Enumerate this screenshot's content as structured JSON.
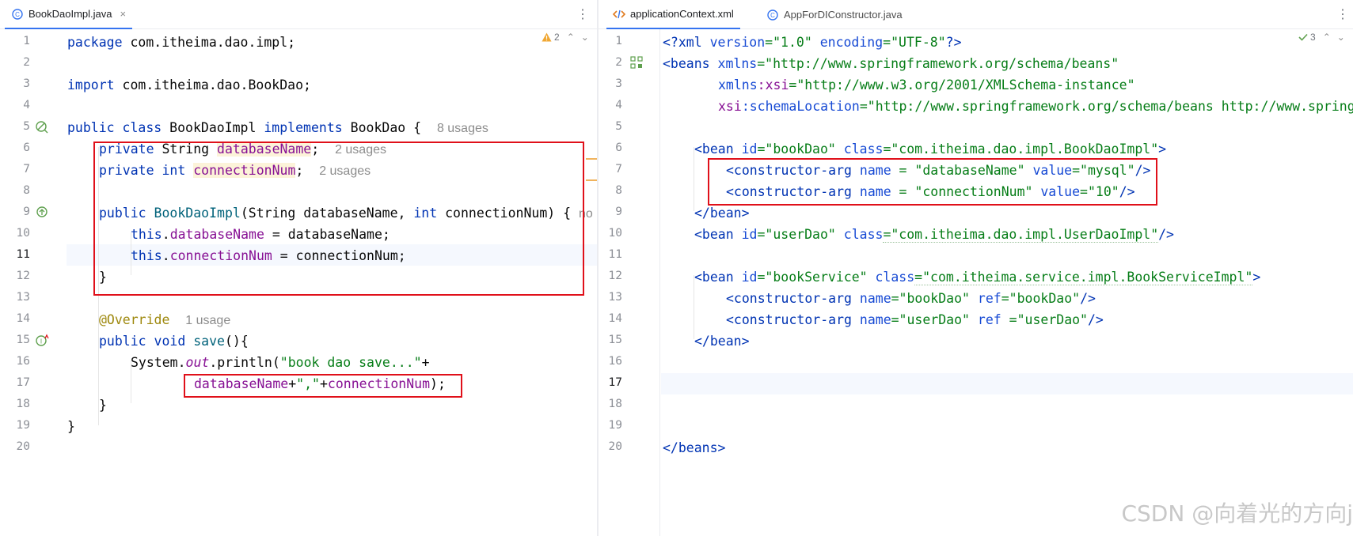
{
  "left_editor": {
    "tab": {
      "label": "BookDaoImpl.java",
      "close": "×",
      "icon": "java-class-icon"
    },
    "kebab": "⋮",
    "inspection": {
      "count": "2",
      "icon": "warning-icon"
    },
    "line_numbers": [
      "1",
      "2",
      "3",
      "4",
      "5",
      "6",
      "7",
      "8",
      "9",
      "10",
      "11",
      "12",
      "13",
      "14",
      "15",
      "16",
      "17",
      "18",
      "19",
      "20"
    ],
    "hints": {
      "class_usages": "8 usages",
      "field1_usages": "2 usages",
      "field2_usages": "2 usages",
      "override_usages": "1 usage",
      "clipped": "no"
    },
    "tokens": {
      "package_kw": "package",
      "package_name": " com.itheima.dao.impl;",
      "import_kw": "import",
      "import_name": " com.itheima.dao.BookDao;",
      "public_kw": "public",
      "class_kw": "class",
      "class_name": "BookDaoImpl",
      "implements_kw": "implements",
      "iface": "BookDao {",
      "private_kw": "private",
      "string_type": "String",
      "field_db": "databaseName",
      "semi": ";",
      "int_kw": "int",
      "field_conn": "connectionNum",
      "ctor_name": "BookDaoImpl",
      "ctor_params_a": "(String databaseName, ",
      "ctor_params_b": " connectionNum) {",
      "this_kw": "this",
      "assign_db": " = databaseName;",
      "assign_conn": " = connectionNum;",
      "close_brace": "}",
      "override": "@Override",
      "void_kw": "void",
      "save_sig": "save",
      "sys": "System.",
      "out": "out",
      "println": ".println(",
      "str_save": "\"book dao save...\"",
      "plus": "+",
      "str_comma": "\",\"",
      "concat_end": ");"
    }
  },
  "right_editor": {
    "tabs": [
      {
        "label": "applicationContext.xml",
        "icon": "xml-file-icon",
        "active": true
      },
      {
        "label": "AppForDIConstructor.java",
        "icon": "java-class-run-icon",
        "active": false
      }
    ],
    "kebab": "⋮",
    "inspection": {
      "count": "3",
      "icon": "check-icon"
    },
    "line_numbers": [
      "1",
      "2",
      "3",
      "4",
      "5",
      "6",
      "7",
      "8",
      "9",
      "10",
      "11",
      "12",
      "13",
      "14",
      "15",
      "16",
      "17",
      "18",
      "19",
      "20"
    ],
    "lines": {
      "l1_pi_open": "<?xml",
      "l1_attr1": " version",
      "l1_val1": "=\"1.0\"",
      "l1_attr2": " encoding",
      "l1_val2": "=\"UTF-8\"",
      "l1_pi_close": "?>",
      "l2_tag": "<beans",
      "l2_attr": " xmlns",
      "l2_val": "=\"http://www.springframework.org/schema/beans\"",
      "l3_attr": "xmlns",
      "l3_ns": ":xsi",
      "l3_val": "=\"http://www.w3.org/2001/XMLSchema-instance\"",
      "l4_ns": "xsi",
      "l4_attr": ":schemaLocation",
      "l4_val": "=\"http://www.springframework.org/schema/beans http://www.springframework.org/schema/beans/spring-beans.xsd\">",
      "bean_open": "<bean",
      "id_attr": " id",
      "class_attr": " class",
      "gt": ">",
      "selfclose": "/>",
      "l6_id": "=\"bookDao\"",
      "l6_class": "=\"com.itheima.dao.impl.BookDaoImpl\"",
      "carg": "<constructor-arg",
      "name_sp": " name",
      "value_attr": " value",
      "l7_name": " = \"databaseName\"",
      "l7_value": "=\"mysql\"",
      "l8_name": " = \"connectionNum\"",
      "l8_value": "=\"10\"",
      "bean_close": "</bean>",
      "l10_id": "=\"userDao\"",
      "l10_class": "=\"com.itheima.dao.impl.UserDaoImpl\"",
      "l12_id": "=\"bookService\"",
      "l12_class": "=\"com.itheima.service.impl.BookServiceImpl\"",
      "ref_attr": " ref",
      "l13_name": "=\"bookDao\"",
      "l13_ref": "=\"bookDao\"",
      "l14_name": "=\"userDao\"",
      "l14_ref_sp": " =\"userDao\"",
      "beans_close": "</beans>"
    }
  },
  "watermark": "CSDN @向着光的方向j",
  "colors": {
    "keyword": "#0033b3",
    "field": "#871094",
    "string": "#067d17",
    "annotation": "#9e880d",
    "highlight_box": "#e0101a",
    "tab_underline": "#3574f0"
  }
}
